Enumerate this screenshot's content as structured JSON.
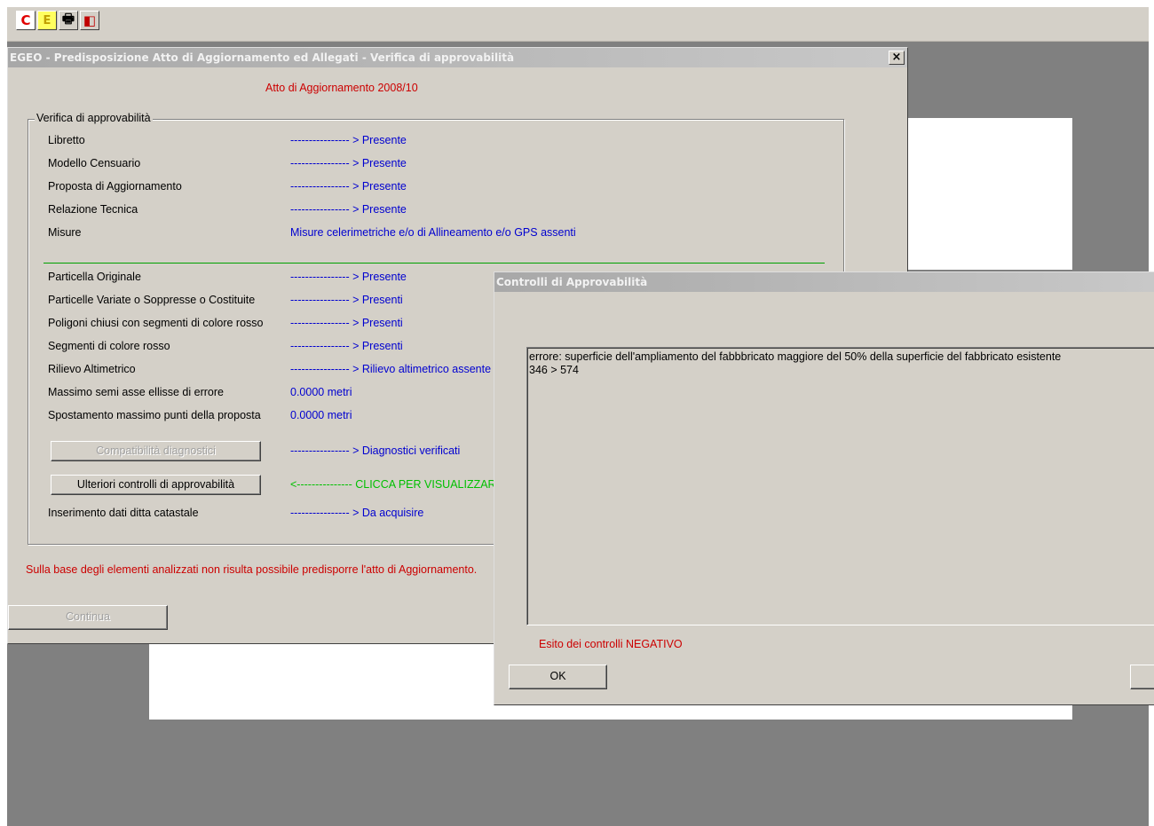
{
  "toolbar": {
    "buttons": [
      {
        "label": "C",
        "color": "#e00000",
        "bg": "#ffffff"
      },
      {
        "label": "E",
        "color": "#e0c000",
        "bg": "#ffff40"
      },
      {
        "label": "🖶",
        "color": "#000000",
        "bg": "#d4d0c8"
      },
      {
        "label": "◧",
        "color": "#c00000",
        "bg": "#d4d0c8"
      }
    ]
  },
  "main_window": {
    "title": "EGEO - Predisposizione Atto di Aggiornamento ed Allegati - Verifica di approvabilità",
    "close_label": "×",
    "subtitle": "Atto di Aggiornamento 2008/10",
    "group_label": "Verifica di approvabilità",
    "rows_top": [
      {
        "label": "Libretto",
        "value": "---------------- > Presente"
      },
      {
        "label": "Modello Censuario",
        "value": "---------------- > Presente"
      },
      {
        "label": "Proposta di Aggiornamento",
        "value": "---------------- > Presente"
      },
      {
        "label": "Relazione Tecnica",
        "value": "---------------- > Presente"
      },
      {
        "label": "Misure",
        "value": "Misure celerimetriche e/o di Allineamento e/o GPS assenti"
      }
    ],
    "rows_bottom": [
      {
        "label": "Particella Originale",
        "value": "---------------- > Presente"
      },
      {
        "label": "Particelle Variate o Soppresse o Costituite",
        "value": "---------------- > Presenti"
      },
      {
        "label": "Poligoni chiusi con segmenti di colore rosso",
        "value": "---------------- > Presenti"
      },
      {
        "label": "Segmenti di colore rosso",
        "value": "---------------- > Presenti"
      },
      {
        "label": "Rilievo Altimetrico",
        "value": "---------------- > Rilievo altimetrico assente"
      },
      {
        "label": "Massimo semi asse ellisse di errore",
        "value": "0.0000  metri"
      },
      {
        "label": "Spostamento massimo punti della proposta",
        "value": "0.0000 metri"
      }
    ],
    "compat_button": "Compatibilità diagnostici",
    "compat_value": "---------------- > Diagnostici verificati",
    "ulteriori_button": "Ulteriori controlli di approvabilità",
    "ulteriori_value": "<--------------- CLICCA PER VISUALIZZAR",
    "ditta_label": "Inserimento dati ditta catastale",
    "ditta_value": "---------------- > Da acquisire",
    "warning": "Sulla base degli elementi analizzati non risulta possibile predisporre l'atto di Aggiornamento.",
    "continua_button": "Continua"
  },
  "dialog": {
    "title": "Controlli di Approvabilità",
    "message_line1": "errore: superficie dell'ampliamento del fabbbricato maggiore del 50% della superficie del fabbricato esistente",
    "message_line2": "346 > 574",
    "result": "Esito dei controlli NEGATIVO",
    "ok_button": "OK"
  }
}
